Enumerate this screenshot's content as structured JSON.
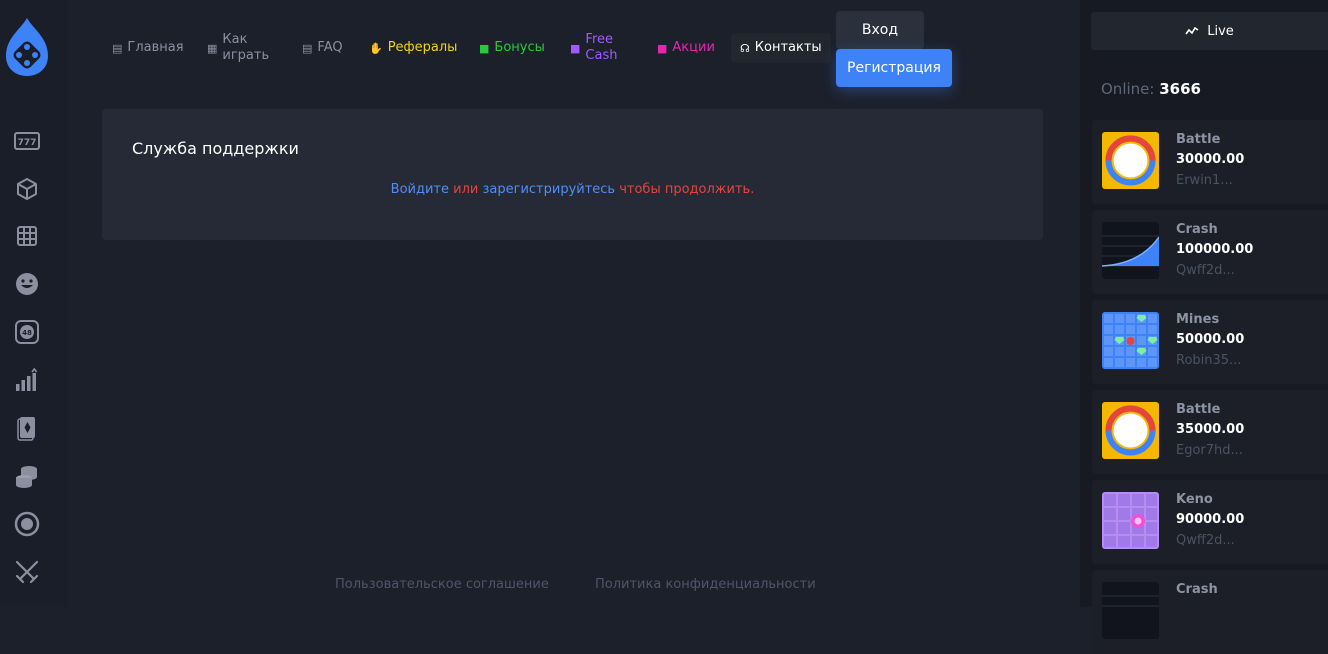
{
  "nav": {
    "home": "Главная",
    "howto": "Как играть",
    "faq": "FAQ",
    "referrals": "Рефералы",
    "bonuses": "Бонусы",
    "freecash": "Free Cash",
    "promos": "Акции",
    "contacts": "Контакты"
  },
  "auth": {
    "login": "Вход",
    "register": "Регистрация"
  },
  "support": {
    "title": "Служба поддержки",
    "login_link": "Войдите",
    "or": " или ",
    "register_link": "зарегистрируйтесь",
    "tail": " чтобы продолжить."
  },
  "footer": {
    "terms": "Пользовательское соглашение",
    "privacy": "Политика конфиденциальности"
  },
  "live": {
    "tab": "Live",
    "online_label": "Online:",
    "online_count": "3666"
  },
  "feed": [
    {
      "game": "Battle",
      "amount": "30000.00",
      "user": "Erwin1..."
    },
    {
      "game": "Crash",
      "amount": "100000.00",
      "user": "Qwff2d..."
    },
    {
      "game": "Mines",
      "amount": "50000.00",
      "user": "Robin35..."
    },
    {
      "game": "Battle",
      "amount": "35000.00",
      "user": "Egor7hd..."
    },
    {
      "game": "Keno",
      "amount": "90000.00",
      "user": "Qwff2d..."
    },
    {
      "game": "Crash"
    }
  ],
  "colors": {
    "accent": "#3e82f7",
    "referrals": "#f5d211",
    "bonuses": "#27c93f",
    "freecash": "#a259ff",
    "promos": "#e925b0"
  },
  "sidebar_icons": [
    "slots-777-icon",
    "cube-icon",
    "grid-icon",
    "smiley-icon",
    "keno-ball-icon",
    "bars-chart-icon",
    "cards-icon",
    "coins-stack-icon",
    "target-circle-icon",
    "crossed-swords-icon"
  ]
}
